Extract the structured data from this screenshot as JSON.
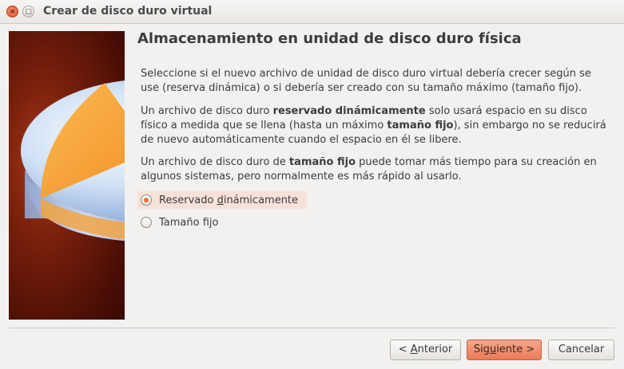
{
  "window": {
    "title": "Crear de disco duro virtual",
    "close_glyph": "×",
    "maximize_glyph": "□"
  },
  "page": {
    "heading": "Almacenamiento en unidad de disco duro física",
    "paragraph1": "Seleccione si el nuevo archivo de unidad de disco duro virtual debería crecer según se use (reserva dinámica) o si debería ser creado con su tamaño máximo (tamaño fijo).",
    "paragraph2": {
      "t1": "Un archivo de disco duro ",
      "b1": "reservado dinámicamente",
      "t2": " solo usará espacio en su disco físico a medida que se llena (hasta un máximo ",
      "b2": "tamaño fijo",
      "t3": "), sin embargo no se reducirá de nuevo automáticamente cuando el espacio en él se libere."
    },
    "paragraph3": {
      "t1": "Un archivo de disco duro de ",
      "b1": "tamaño fijo",
      "t2": " puede tomar más tiempo para su creación en algunos sistemas, pero normalmente es más rápido al usarlo."
    },
    "options": [
      {
        "label_pre": "Reservado ",
        "label_mnemonic": "d",
        "label_post": "inámicamente",
        "checked": true
      },
      {
        "label_pre": "Tamaño fijo",
        "label_mnemonic": "",
        "label_post": "",
        "checked": false
      }
    ]
  },
  "buttons": {
    "back": {
      "pre": "< ",
      "mnemonic": "A",
      "post": "nterior"
    },
    "next": {
      "pre": "Sig",
      "mnemonic": "u",
      "post": "iente >"
    },
    "cancel": "Cancelar"
  },
  "colors": {
    "accent": "#ec7a57",
    "selection_bg": "#f8e1d8",
    "side_panel": "#7a200c"
  },
  "icons": {
    "side_image": "disk-pie-chart-icon"
  }
}
